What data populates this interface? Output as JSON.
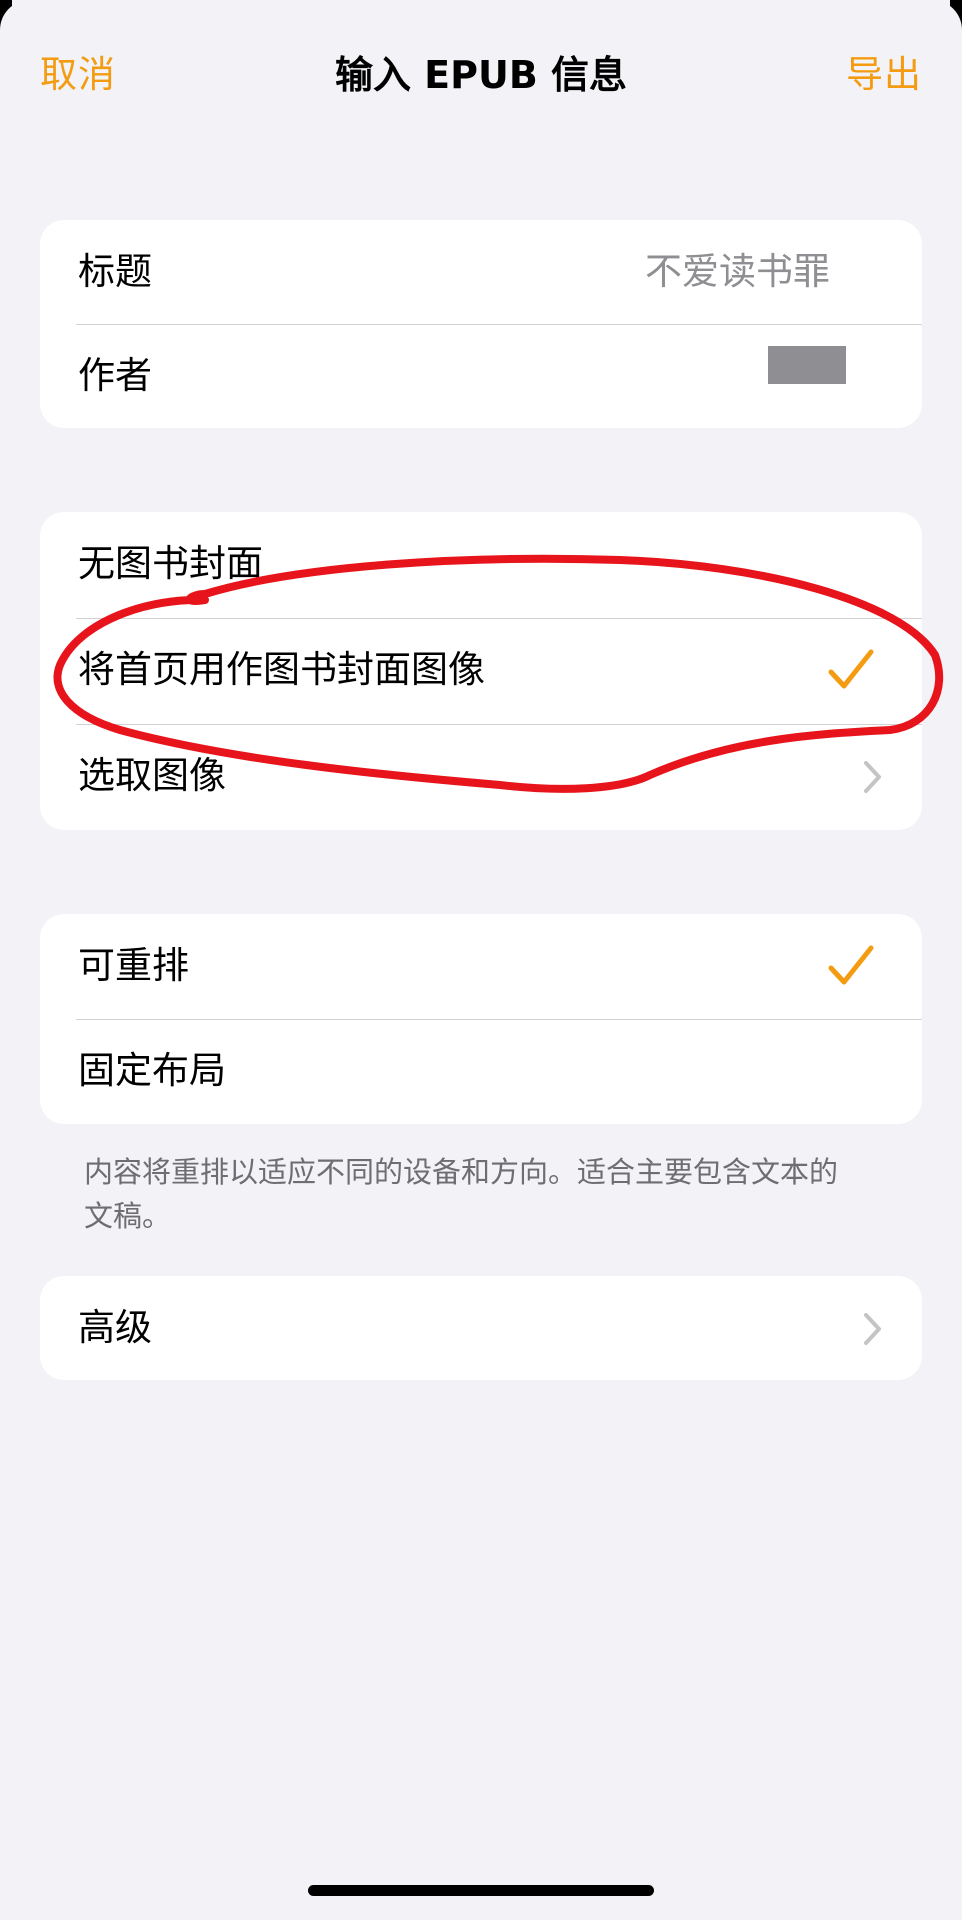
{
  "nav": {
    "cancel": "取消",
    "title": "输入 EPUB 信息",
    "export": "导出"
  },
  "metadata": {
    "title_label": "标题",
    "title_placeholder": "不爱读书罪",
    "author_label": "作者"
  },
  "cover": {
    "none": "无图书封面",
    "first_page": "将首页用作图书封面图像",
    "choose_image": "选取图像"
  },
  "layout": {
    "reflowable": "可重排",
    "fixed": "固定布局",
    "footnote": "内容将重排以适应不同的设备和方向。适合主要包含文本的文稿。"
  },
  "advanced": {
    "label": "高级"
  },
  "colors": {
    "accent": "#f39c12",
    "annotation": "#e8141b"
  },
  "icons": {
    "check": "checkmark-icon",
    "chevron": "chevron-right-icon"
  }
}
